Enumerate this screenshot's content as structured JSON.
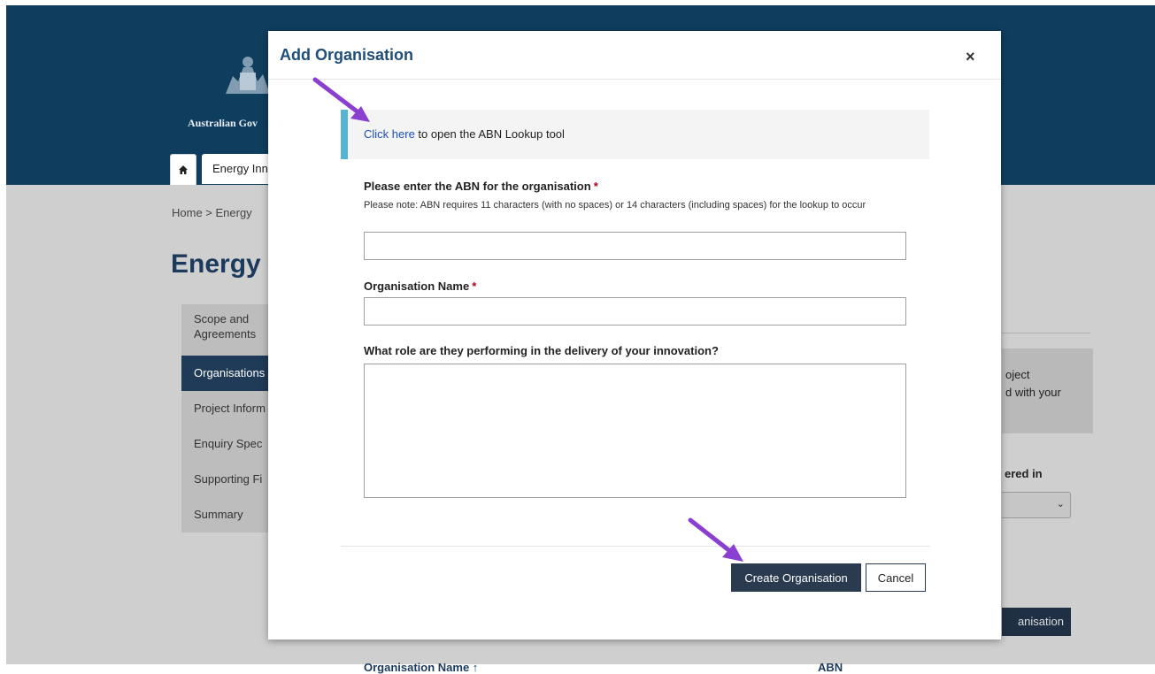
{
  "background_page": {
    "gov_name": "Australian Gov",
    "top_tab_label": "Energy Inn",
    "breadcrumb": "Home  >  Energy",
    "page_title": "Energy I",
    "sidenav": [
      "Scope and Agreements",
      "Organisations",
      "Project Inform",
      "Enquiry Spec",
      "Supporting Fi",
      "Summary"
    ],
    "info_box_lines": [
      "oject",
      "d with your"
    ],
    "question_fragment": "ered in",
    "button_fragment": "anisation",
    "table_headers": [
      "Organisation Name ↑",
      "ABN"
    ]
  },
  "modal": {
    "title": "Add Organisation",
    "close_glyph": "×",
    "callout": {
      "link_text": "Click here",
      "text": " to open the ABN Lookup tool"
    },
    "abn_field": {
      "label": "Please enter the ABN for the organisation",
      "required_mark": "*",
      "note": "Please note: ABN requires 11 characters (with no spaces) or 14 characters (including spaces) for the lookup to occur",
      "value": ""
    },
    "name_field": {
      "label": "Organisation Name",
      "required_mark": "*",
      "value": ""
    },
    "role_field": {
      "label": "What role are they performing in the delivery of your innovation?",
      "value": ""
    },
    "create_button": "Create Organisation",
    "cancel_button": "Cancel"
  },
  "colors": {
    "header_navy": "#0f3d5e",
    "title_blue": "#1f4e79",
    "callout_accent": "#56b4d3",
    "primary_button": "#2a3a4f",
    "arrow": "#8a3fd1",
    "required": "#b00020"
  }
}
